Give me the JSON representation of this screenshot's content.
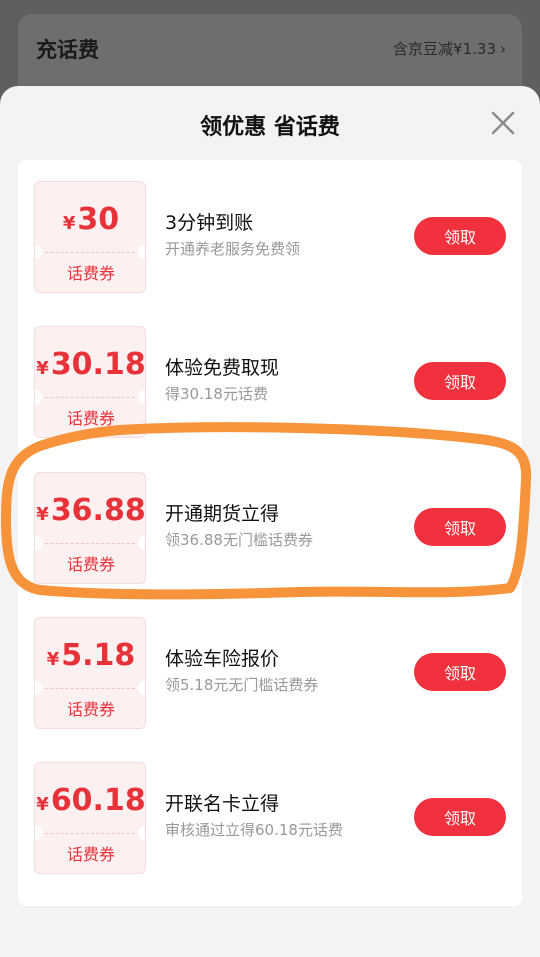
{
  "background": {
    "title": "充话费",
    "right_text": "含京豆减¥1.33",
    "chevron": "›"
  },
  "sheet": {
    "title": "领优惠 省话费"
  },
  "coupons": [
    {
      "symbol": "¥",
      "amount": "30",
      "type": "话费券",
      "title": "3分钟到账",
      "subtitle": "开通养老服务免费领",
      "button": "领取"
    },
    {
      "symbol": "¥",
      "amount": "30.18",
      "type": "话费券",
      "title": "体验免费取现",
      "subtitle": "得30.18元话费",
      "button": "领取"
    },
    {
      "symbol": "¥",
      "amount": "36.88",
      "type": "话费券",
      "title": "开通期货立得",
      "subtitle": "领36.88无门槛话费券",
      "button": "领取"
    },
    {
      "symbol": "¥",
      "amount": "5.18",
      "type": "话费券",
      "title": "体验车险报价",
      "subtitle": "领5.18元无门槛话费券",
      "button": "领取"
    },
    {
      "symbol": "¥",
      "amount": "60.18",
      "type": "话费券",
      "title": "开联名卡立得",
      "subtitle": "审核通过立得60.18元话费",
      "button": "领取"
    }
  ],
  "colors": {
    "accent": "#f2313f",
    "coupon_text": "#e8323a",
    "highlight_stroke": "#f7933a"
  }
}
